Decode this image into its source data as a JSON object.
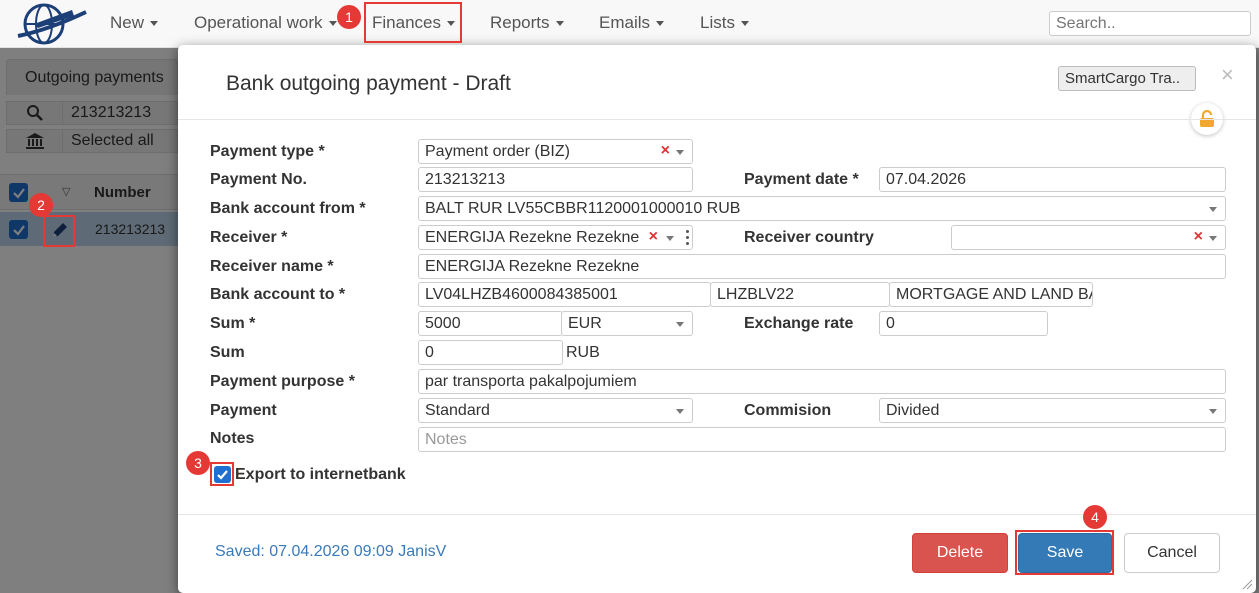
{
  "nav": {
    "items": [
      {
        "label": "New"
      },
      {
        "label": "Operational work"
      },
      {
        "label": "Finances"
      },
      {
        "label": "Reports"
      },
      {
        "label": "Emails"
      },
      {
        "label": "Lists"
      }
    ],
    "search_placeholder": "Search.."
  },
  "background": {
    "tab_label": "Outgoing payments",
    "filter_value": "213213213",
    "filter_selected": "Selected all",
    "column_number": "Number",
    "row_number": "213213213"
  },
  "modal": {
    "title": "Bank outgoing payment - Draft",
    "company": "SmartCargo Tra..",
    "close_symbol": "×",
    "fields": {
      "payment_type_label": "Payment type *",
      "payment_type_value": "Payment order (BIZ)",
      "payment_no_label": "Payment No.",
      "payment_no_value": "213213213",
      "payment_date_label": "Payment date *",
      "payment_date_value": "07.04.2026",
      "bank_from_label": "Bank account from *",
      "bank_from_value": "BALT RUR LV55CBBR1120001000010 RUB",
      "receiver_label": "Receiver *",
      "receiver_value": "ENERGIJA Rezekne Rezekne",
      "receiver_country_label": "Receiver country",
      "receiver_country_value": "",
      "receiver_name_label": "Receiver name *",
      "receiver_name_value": "ENERGIJA Rezekne Rezekne",
      "bank_to_label": "Bank account to *",
      "bank_to_iban": "LV04LHZB4600084385001",
      "bank_to_swift": "LHZBLV22",
      "bank_to_bank": "MORTGAGE AND LAND BANK",
      "sum_label": "Sum *",
      "sum_value": "5000",
      "sum_currency": "EUR",
      "exchange_rate_label": "Exchange rate",
      "exchange_rate_value": "0",
      "sum2_label": "Sum",
      "sum2_value": "0",
      "sum2_currency": "RUB",
      "purpose_label": "Payment purpose *",
      "purpose_value": "par transporta pakalpojumiem",
      "payment_label": "Payment",
      "payment_value": "Standard",
      "commision_label": "Commision",
      "commision_value": "Divided",
      "notes_label": "Notes",
      "notes_placeholder": "Notes",
      "export_label": "Export to internetbank",
      "export_checked": true
    },
    "saved_text": "Saved: 07.04.2026 09:09 JanisV",
    "buttons": {
      "delete": "Delete",
      "save": "Save",
      "cancel": "Cancel"
    }
  },
  "annotations": [
    "1",
    "2",
    "3",
    "4"
  ],
  "colors": {
    "primary": "#337ab7",
    "danger": "#d9534f",
    "highlight": "#e53935",
    "saved_text": "#3a7ab8"
  }
}
